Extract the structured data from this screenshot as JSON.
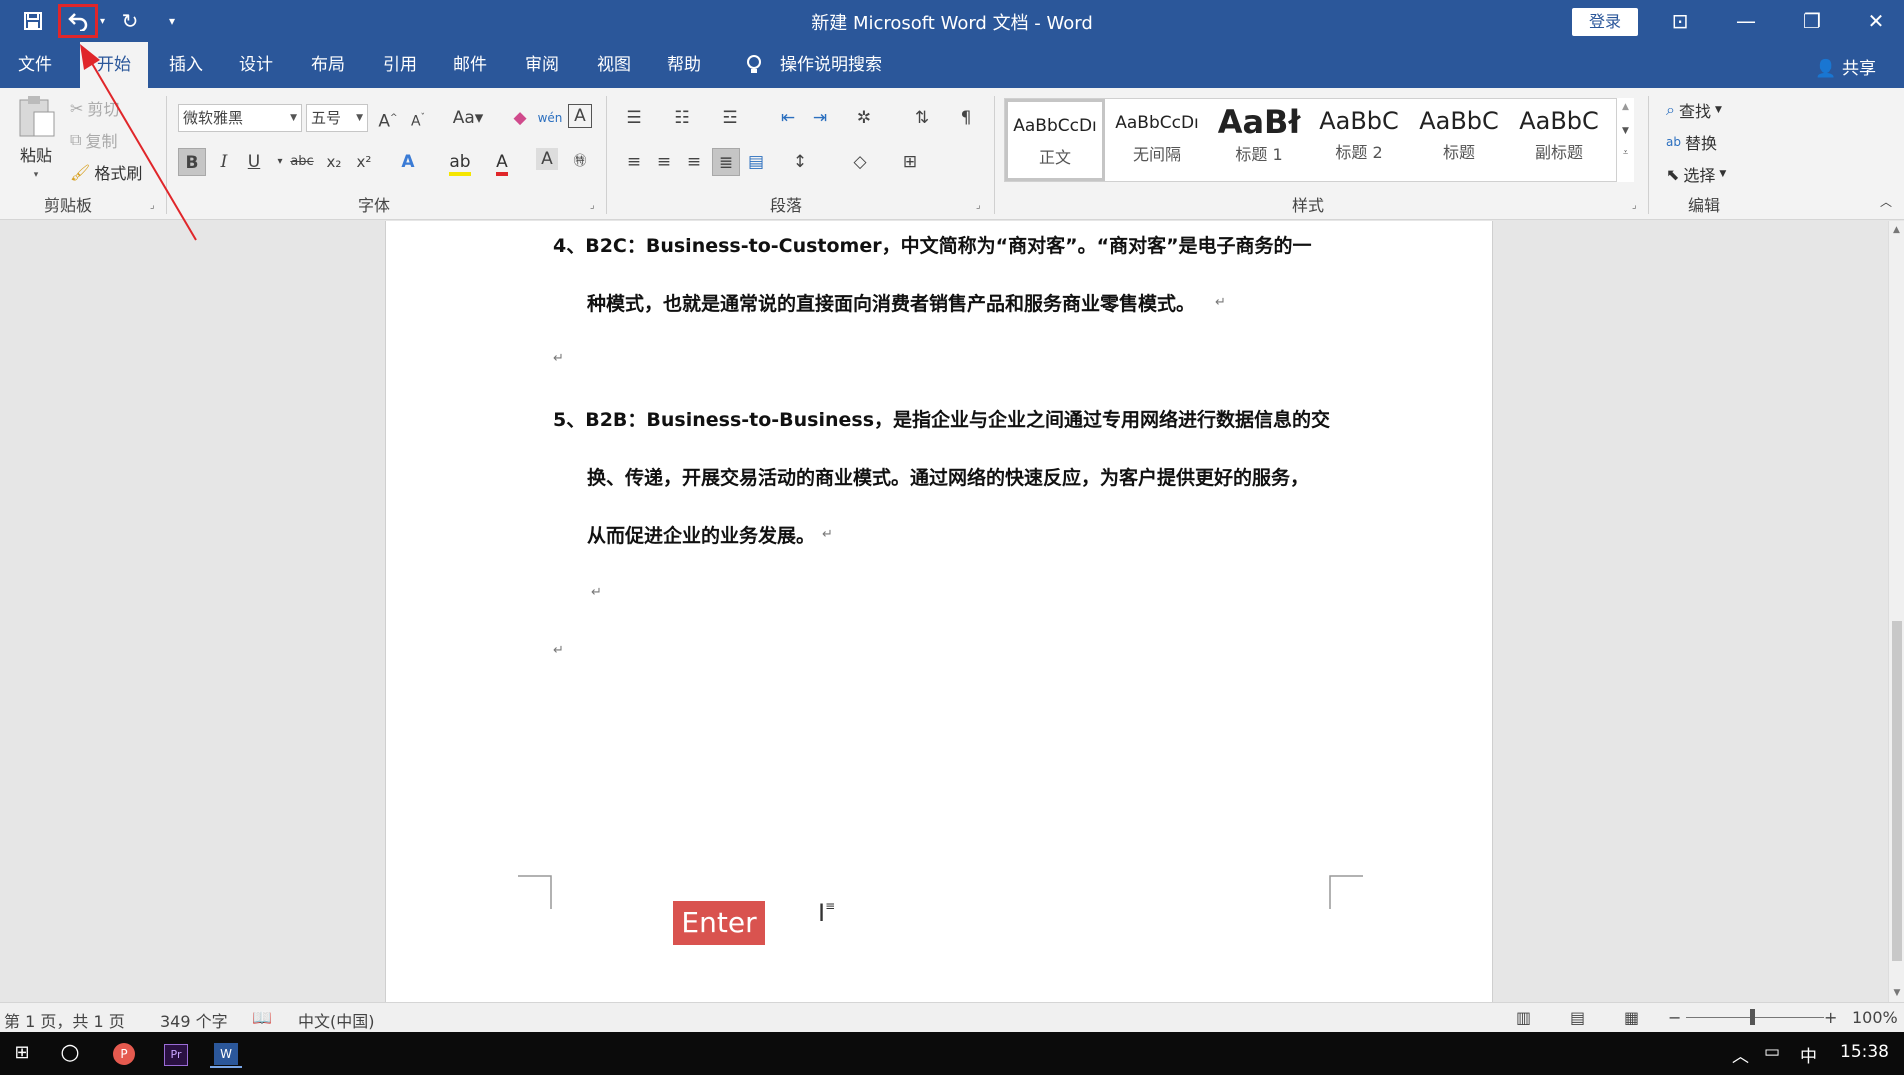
{
  "window": {
    "title": "新建 Microsoft Word 文档  -  Word",
    "login_label": "登录"
  },
  "tabs": [
    {
      "label": "文件"
    },
    {
      "label": "开始"
    },
    {
      "label": "插入"
    },
    {
      "label": "设计"
    },
    {
      "label": "布局"
    },
    {
      "label": "引用"
    },
    {
      "label": "邮件"
    },
    {
      "label": "审阅"
    },
    {
      "label": "视图"
    },
    {
      "label": "帮助"
    },
    {
      "label": "操作说明搜索"
    }
  ],
  "share_label": "共享",
  "clipboard": {
    "paste": "粘贴",
    "cut": "剪切",
    "copy": "复制",
    "format_painter": "格式刷",
    "group": "剪贴板"
  },
  "font": {
    "name": "微软雅黑",
    "size": "五号",
    "group": "字体",
    "bold": "B",
    "italic": "I",
    "underline": "U",
    "strike": "abc",
    "sub": "x₂",
    "sup": "x²",
    "change_case": "Aa"
  },
  "paragraph": {
    "group": "段落"
  },
  "styles": {
    "group": "样式",
    "items": [
      {
        "sample": "AaBbCcDı",
        "name": "正文"
      },
      {
        "sample": "AaBbCcDı",
        "name": "无间隔"
      },
      {
        "sample": "AaBł",
        "name": "标题 1"
      },
      {
        "sample": "AaBbC",
        "name": "标题 2"
      },
      {
        "sample": "AaBbC",
        "name": "标题"
      },
      {
        "sample": "AaBbC",
        "name": "副标题"
      }
    ]
  },
  "editing": {
    "find": "查找",
    "replace": "替换",
    "select": "选择",
    "group": "编辑"
  },
  "document": {
    "lines": [
      "4、B2C：Business-to-Customer，中文简称为“商对客”。“商对客”是电子商务的一",
      "种模式，也就是通常说的直接面向消费者销售产品和服务商业零售模式。",
      "5、B2B：Business-to-Business，是指企业与企业之间通过专用网络进行数据信息的交",
      "换、传递，开展交易活动的商业模式。通过网络的快速反应，为客户提供更好的服务，",
      "从而促进企业的业务发展。"
    ],
    "enter_label": "Enter"
  },
  "status": {
    "page": "第 1 页，共 1 页",
    "words": "349 个字",
    "language": "中文(中国)",
    "zoom": "100%"
  },
  "taskbar": {
    "ime": "中",
    "time": "15:38"
  },
  "colors": {
    "brand": "#2b579a",
    "annotation": "#e0262a",
    "enter_badge": "#d9534f"
  }
}
